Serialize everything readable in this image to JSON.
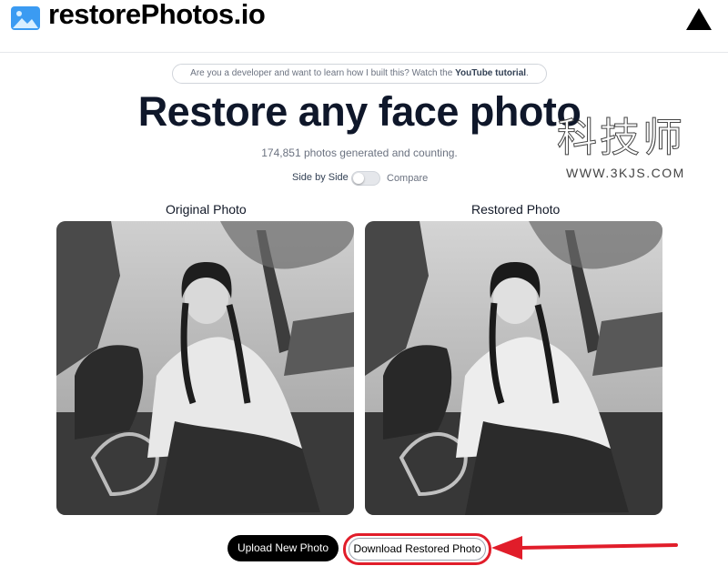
{
  "header": {
    "brand": "restorePhotos.io",
    "logo_icon": "image-icon",
    "vercel_icon": "triangle-icon"
  },
  "banner": {
    "text": "Are you a developer and want to learn how I built this? Watch the ",
    "link": "YouTube tutorial",
    "suffix": "."
  },
  "hero": {
    "title": "Restore any face photo",
    "counter": "174,851 photos generated and counting."
  },
  "toggle": {
    "left_label": "Side by Side",
    "right_label": "Compare",
    "state": "off"
  },
  "photos": {
    "original_label": "Original Photo",
    "restored_label": "Restored Photo"
  },
  "actions": {
    "upload": "Upload New Photo",
    "download": "Download Restored Photo"
  },
  "annotation": {
    "color": "#e11d2a"
  },
  "watermark": {
    "chars": "科技师",
    "url": "WWW.3KJS.COM"
  }
}
